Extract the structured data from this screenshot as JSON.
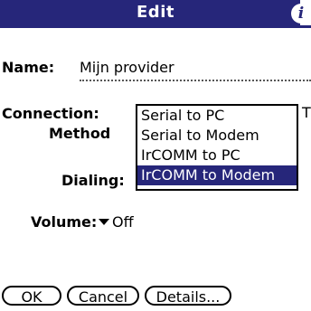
{
  "titlebar": {
    "title": "Edit",
    "info_glyph": "i"
  },
  "form": {
    "name_label": "Name:",
    "name_value": "Mijn provider",
    "connection_label_line1": "Connection:",
    "connection_label_line2": "Method",
    "dialing_label": "Dialing:",
    "volume_label": "Volume:",
    "volume_value": "Off",
    "clipped_char": "T"
  },
  "connection_popup": {
    "options": [
      {
        "label": "Serial to PC",
        "selected": false
      },
      {
        "label": "Serial to Modem",
        "selected": false
      },
      {
        "label": "IrCOMM to PC",
        "selected": false
      },
      {
        "label": "IrCOMM to Modem",
        "selected": true
      }
    ]
  },
  "buttons": {
    "ok": "OK",
    "cancel": "Cancel",
    "details": "Details..."
  },
  "colors": {
    "accent": "#26267a",
    "background": "#ffffff"
  },
  "icons": {
    "info": "info-icon",
    "dropdown": "triangle-down-icon"
  }
}
